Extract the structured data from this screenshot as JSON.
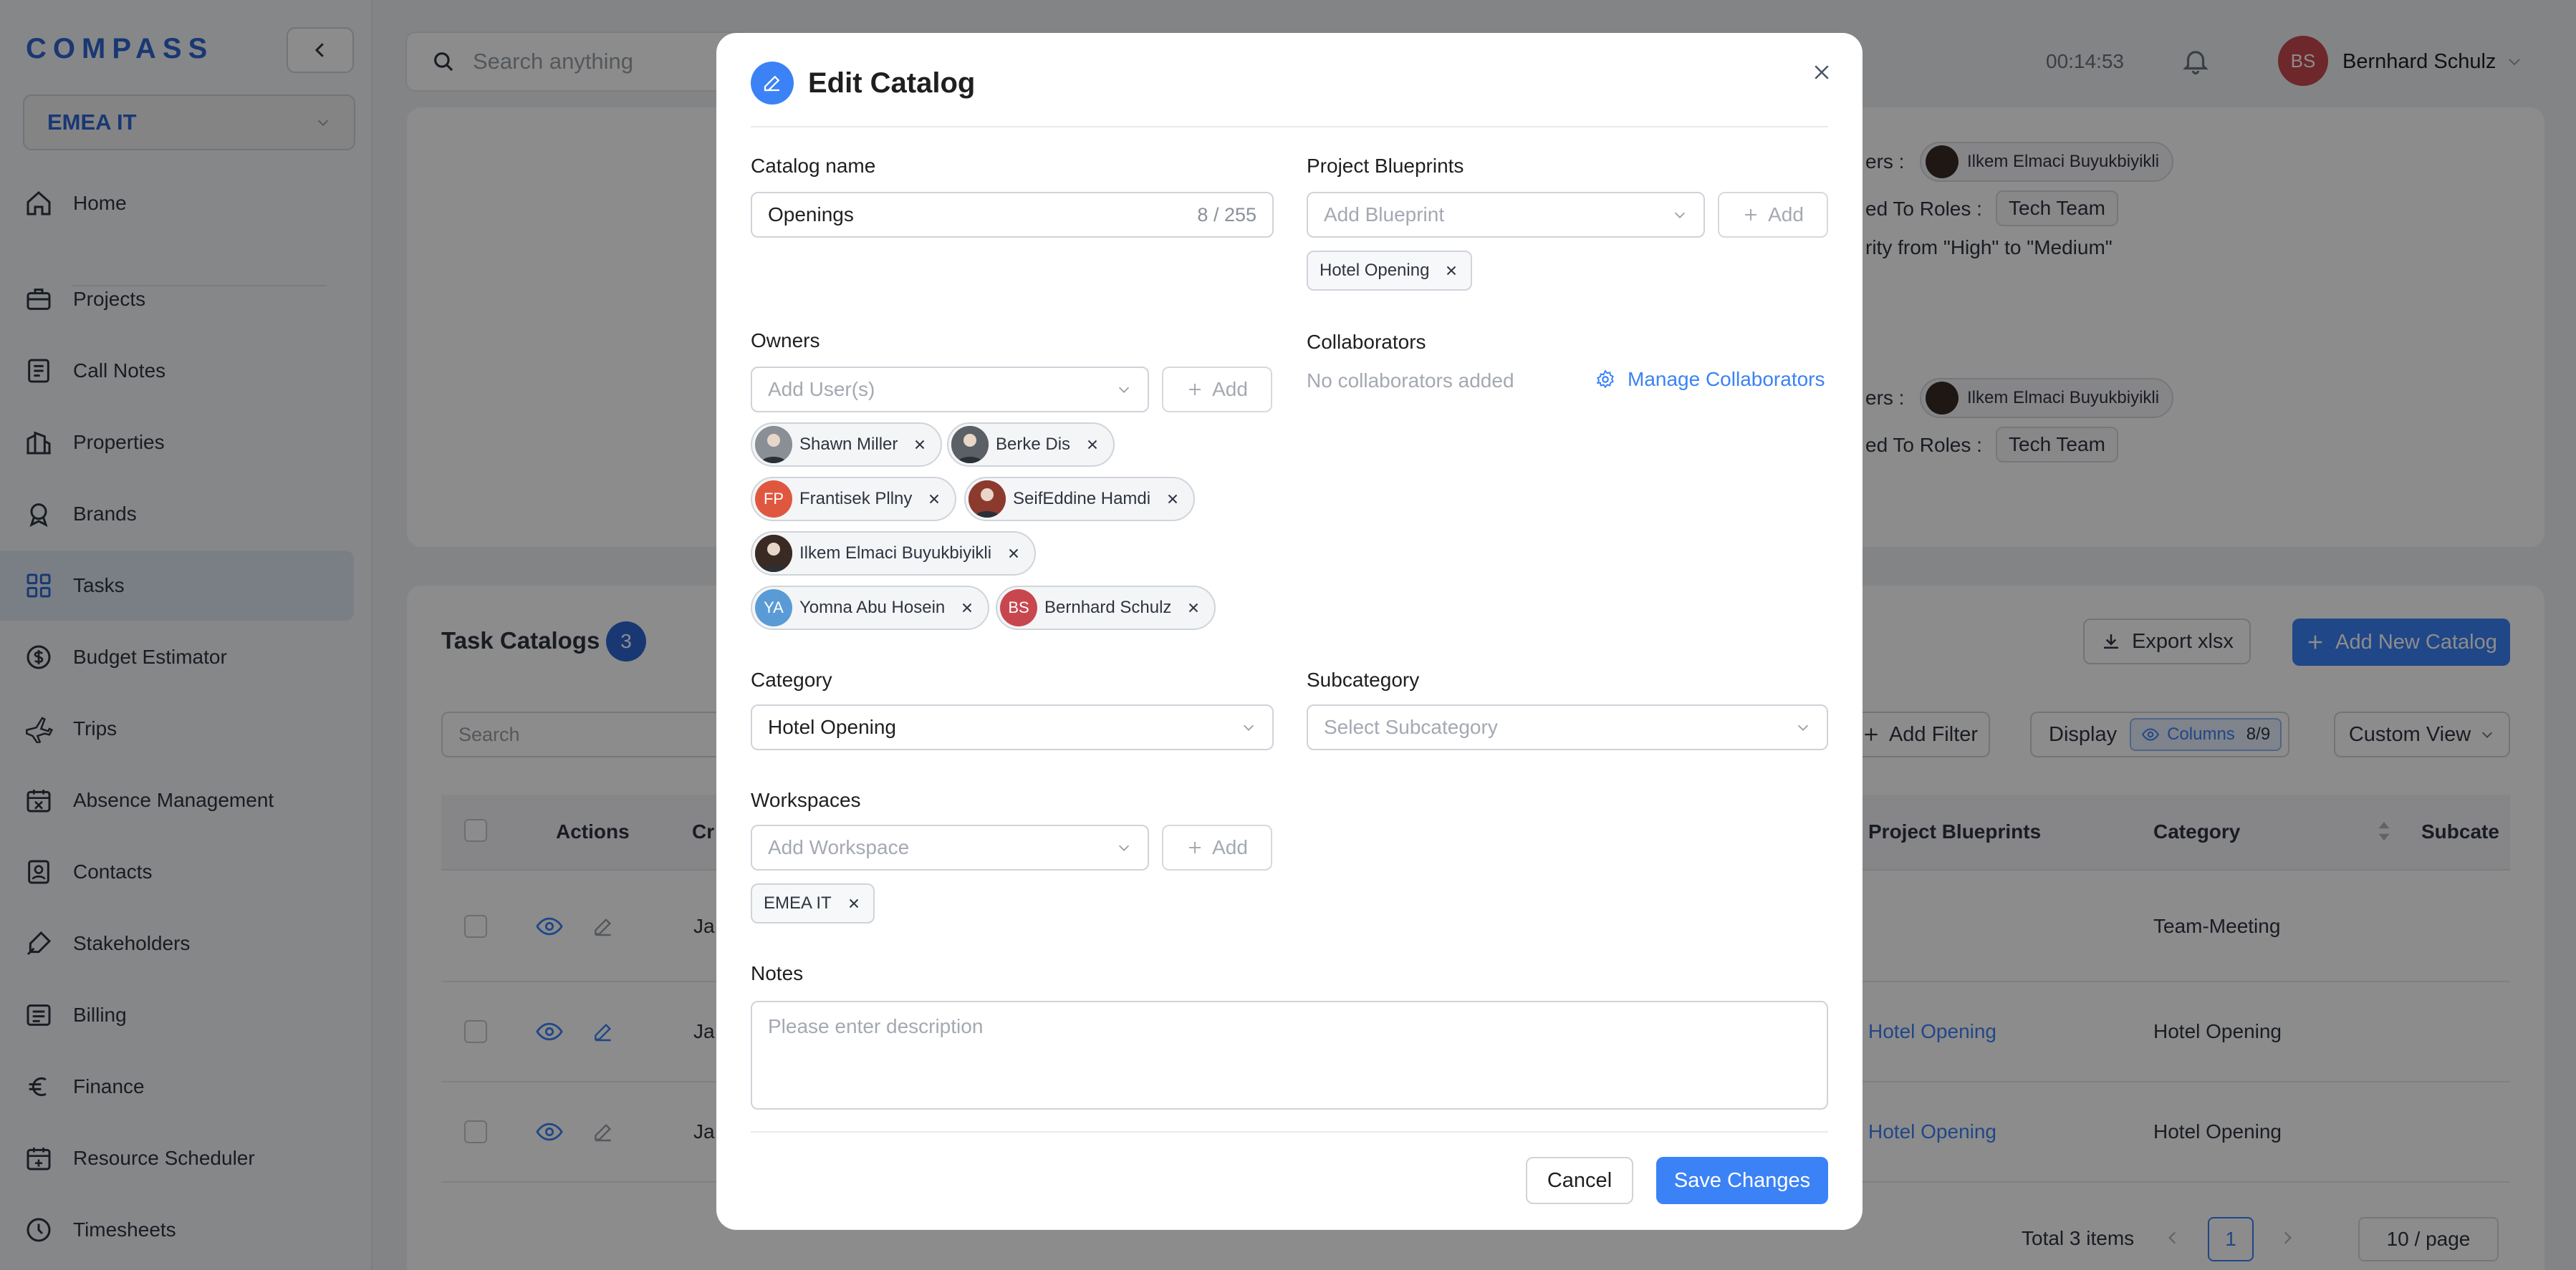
{
  "app": {
    "logo": "COMPASS",
    "org": "EMEA IT"
  },
  "nav": [
    {
      "label": "Home",
      "icon": "home-icon"
    },
    {
      "label": "Projects",
      "icon": "briefcase-icon"
    },
    {
      "label": "Call Notes",
      "icon": "notes-icon"
    },
    {
      "label": "Properties",
      "icon": "building-icon"
    },
    {
      "label": "Brands",
      "icon": "badge-icon"
    },
    {
      "label": "Tasks",
      "icon": "grid-icon"
    },
    {
      "label": "Budget Estimator",
      "icon": "dollar-icon"
    },
    {
      "label": "Trips",
      "icon": "plane-icon"
    },
    {
      "label": "Absence Management",
      "icon": "calendar-x-icon"
    },
    {
      "label": "Contacts",
      "icon": "contacts-icon"
    },
    {
      "label": "Stakeholders",
      "icon": "pen-icon"
    },
    {
      "label": "Billing",
      "icon": "billing-icon"
    },
    {
      "label": "Finance",
      "icon": "euro-icon"
    },
    {
      "label": "Resource Scheduler",
      "icon": "calendar-plus-icon"
    },
    {
      "label": "Timesheets",
      "icon": "clock-icon"
    }
  ],
  "topbar": {
    "search_placeholder": "Search anything",
    "timer": "00:14:53",
    "user_initials": "BS",
    "user_name": "Bernhard Schulz"
  },
  "background": {
    "activity": {
      "owners_label_1": "ers  :",
      "owner_chip_1": "Ilkem Elmaci Buyukbiyikli",
      "roles_label_1": "ed To Roles  :",
      "role_chip_1": "Tech Team",
      "priority_text": "rity  from  \"High\"  to  \"Medium\"",
      "owners_label_2": "ers  :",
      "owner_chip_2": "Ilkem Elmaci Buyukbiyikli",
      "roles_label_2": "ed To Roles  :",
      "role_chip_2": "Tech Team"
    },
    "section_title": "Task Catalogs",
    "count": "3",
    "export_label": "Export xlsx",
    "add_catalog_label": "Add New Catalog",
    "search_placeholder": "Search",
    "add_filter_label": "Add Filter",
    "display_label": "Display",
    "columns_label": "Columns",
    "columns_count": "8/9",
    "custom_view_label": "Custom View",
    "columns": [
      "Actions",
      "Cr",
      "Project Blueprints",
      "Category",
      "Subcate"
    ],
    "rows": [
      {
        "created": "Ja",
        "blueprint": "",
        "category": "Team-Meeting"
      },
      {
        "created": "Ja",
        "blueprint": "Hotel Opening",
        "category": "Hotel Opening"
      },
      {
        "created": "Ja",
        "blueprint": "Hotel Opening",
        "category": "Hotel Opening"
      }
    ],
    "pager": {
      "total": "Total 3 items",
      "page": "1",
      "size": "10 / page"
    }
  },
  "modal": {
    "title": "Edit Catalog",
    "catalog_name_label": "Catalog name",
    "catalog_name_value": "Openings",
    "catalog_name_counter": "8 / 255",
    "blueprints_label": "Project Blueprints",
    "blueprint_placeholder": "Add Blueprint",
    "add_label": "Add",
    "blueprint_tags": [
      "Hotel Opening"
    ],
    "owners_label": "Owners",
    "owners_placeholder": "Add User(s)",
    "owners": [
      {
        "name": "Shawn Miller",
        "initials": "",
        "color": "#8a8f96"
      },
      {
        "name": "Berke Dis",
        "initials": "",
        "color": "#5b5f66"
      },
      {
        "name": "Frantisek Pllny",
        "initials": "FP",
        "color": "#e0573f"
      },
      {
        "name": "SeifEddine Hamdi",
        "initials": "",
        "color": "#8d3a2e"
      },
      {
        "name": "Ilkem Elmaci Buyukbiyikli",
        "initials": "",
        "color": "#3a2a24"
      },
      {
        "name": "Yomna Abu Hosein",
        "initials": "YA",
        "color": "#5a9bd5"
      },
      {
        "name": "Bernhard Schulz",
        "initials": "BS",
        "color": "#c8474f"
      }
    ],
    "collaborators_label": "Collaborators",
    "collaborators_empty": "No collaborators added",
    "manage_collaborators": "Manage Collaborators",
    "category_label": "Category",
    "category_value": "Hotel Opening",
    "subcategory_label": "Subcategory",
    "subcategory_placeholder": "Select Subcategory",
    "workspaces_label": "Workspaces",
    "workspace_placeholder": "Add Workspace",
    "workspace_tags": [
      "EMEA IT"
    ],
    "notes_label": "Notes",
    "notes_placeholder": "Please enter description",
    "cancel_label": "Cancel",
    "save_label": "Save Changes"
  },
  "colors": {
    "accent": "#3b82f6",
    "brand": "#2f67d1"
  }
}
